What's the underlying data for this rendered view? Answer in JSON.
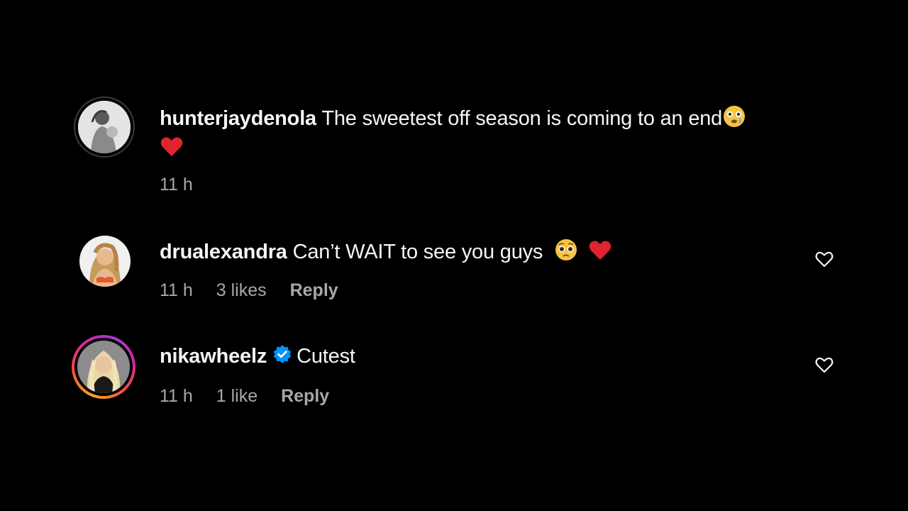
{
  "comments": [
    {
      "username": "hunterjaydenola",
      "text": "The sweetest off season is coming to an end",
      "emoji_1": "teary-face-emoji",
      "emoji_2": "red-heart-emoji",
      "time": "11 h"
    },
    {
      "username": "drualexandra",
      "text": "Can’t WAIT to see you guys",
      "emoji_1": "pleading-face-emoji",
      "emoji_2": "red-heart-emoji",
      "time": "11 h",
      "likes": "3 likes",
      "reply": "Reply",
      "like_icon": "heart-outline-icon"
    },
    {
      "username": "nikawheelz",
      "verified_icon": "verified-badge-icon",
      "text": "Cutest",
      "time": "11 h",
      "likes": "1 like",
      "reply": "Reply",
      "like_icon": "heart-outline-icon"
    }
  ],
  "colors": {
    "background": "#000000",
    "text": "#f5f5f5",
    "meta": "#a8a8a8",
    "verified": "#0095f6",
    "heart": "#e0242f",
    "story_ring_start": "#f9a825",
    "story_ring_end": "#d6249f"
  }
}
